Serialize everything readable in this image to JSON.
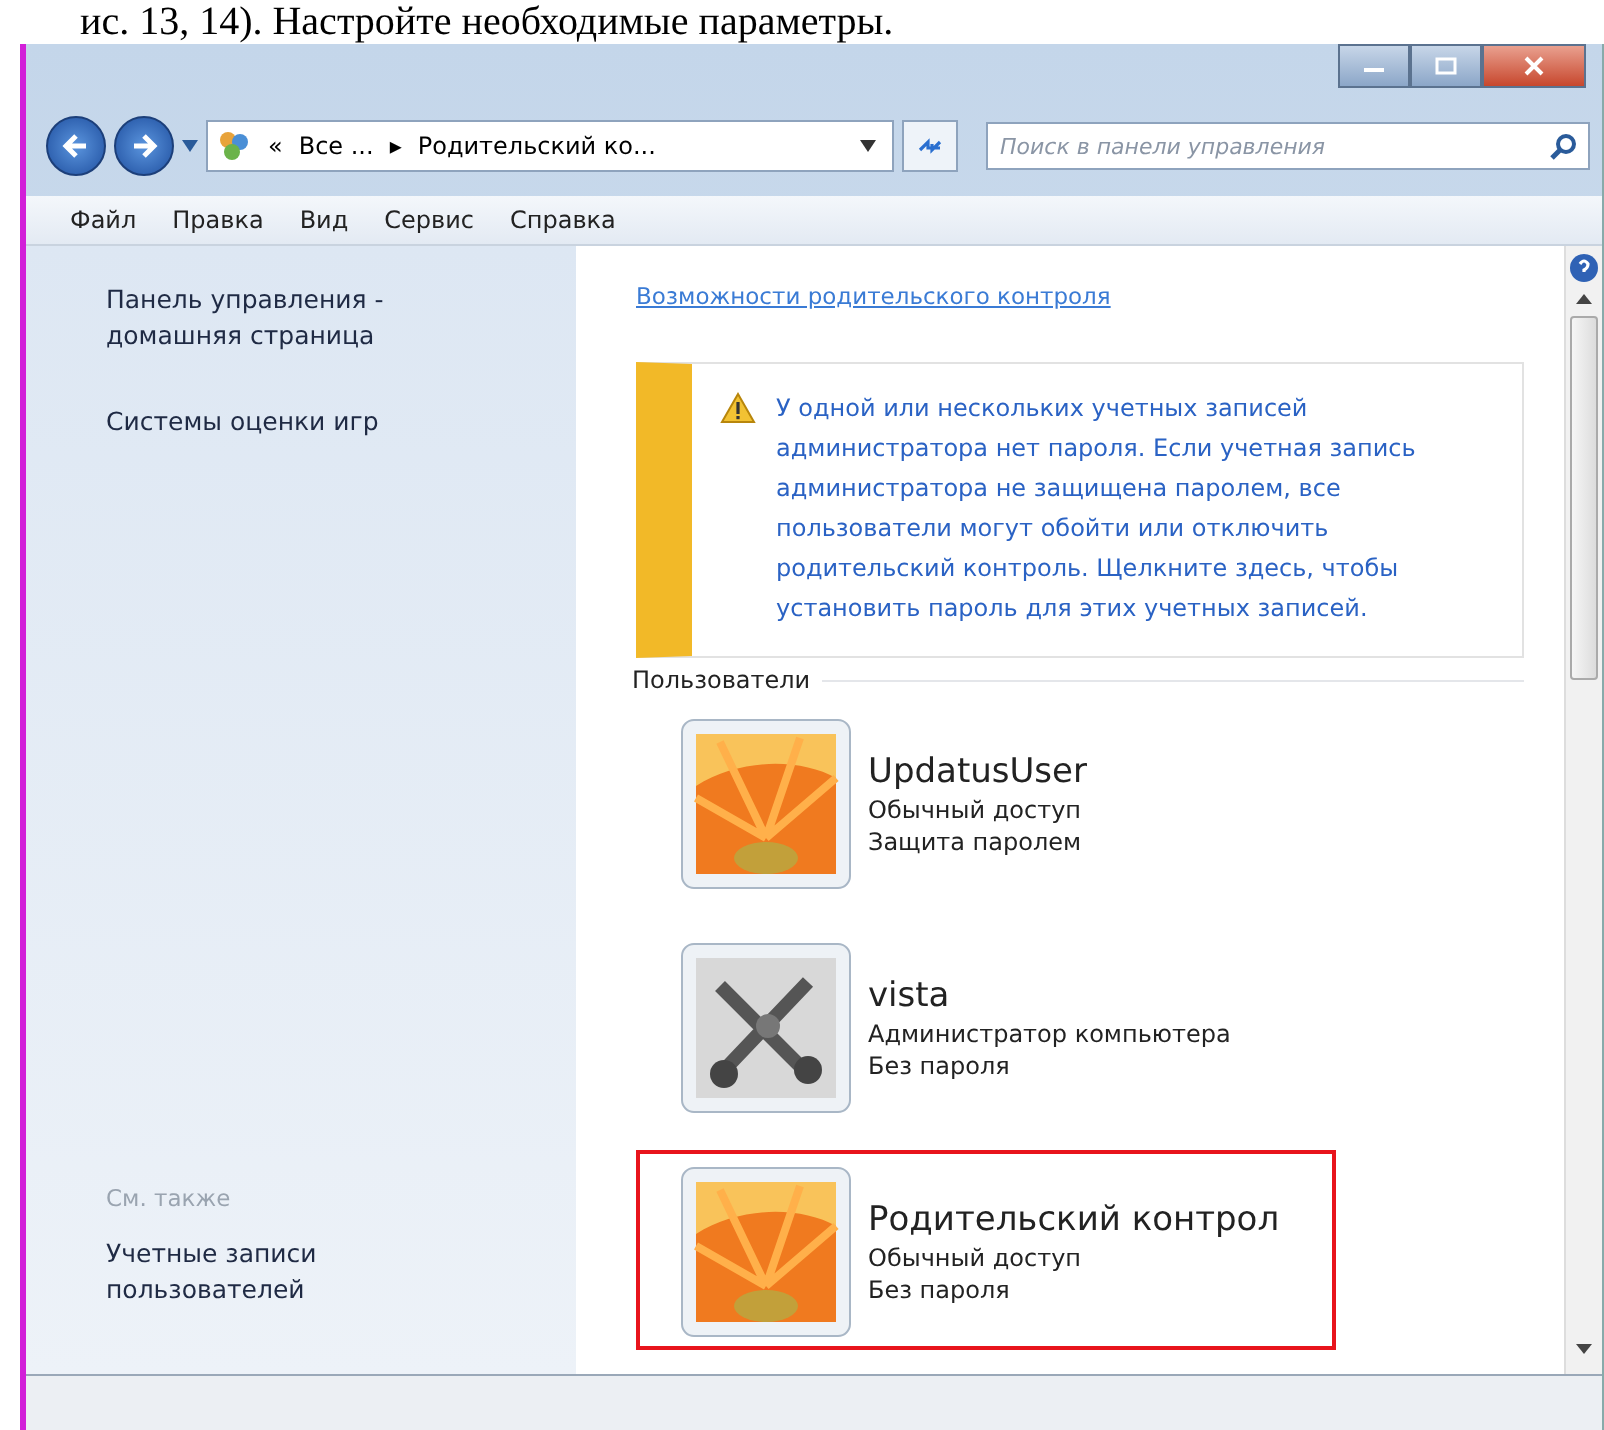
{
  "document_caption": "ис. 13, 14). Настройте необходимые параметры.",
  "address_bar": {
    "crumbs": [
      "«",
      "Все ...",
      "▸",
      "Родительский ко..."
    ]
  },
  "search": {
    "placeholder": "Поиск в панели управления"
  },
  "menu": [
    "Файл",
    "Правка",
    "Вид",
    "Сервис",
    "Справка"
  ],
  "sidebar": {
    "links": [
      "Панель управления - домашняя страница",
      "Системы оценки игр"
    ],
    "see_also_heading": "См. также",
    "see_also_links": [
      "Учетные записи пользователей"
    ]
  },
  "content": {
    "link": "Возможности родительского контроля",
    "warning": "У одной или нескольких учетных записей администратора нет пароля. Если учетная запись администратора не защищена паролем, все пользователи могут обойти или отключить родительский контроль. Щелкните здесь, чтобы установить пароль для этих учетных записей.",
    "users_heading": "Пользователи",
    "users": [
      {
        "name": "UpdatusUser",
        "role": "Обычный доступ",
        "password": "Защита паролем",
        "kind": "flower",
        "highlighted": false
      },
      {
        "name": "vista",
        "role": "Администратор компьютера",
        "password": "Без пароля",
        "kind": "tools",
        "highlighted": false
      },
      {
        "name": "Родительский контрол",
        "role": "Обычный доступ",
        "password": "Без пароля",
        "kind": "flower",
        "highlighted": true
      }
    ]
  }
}
